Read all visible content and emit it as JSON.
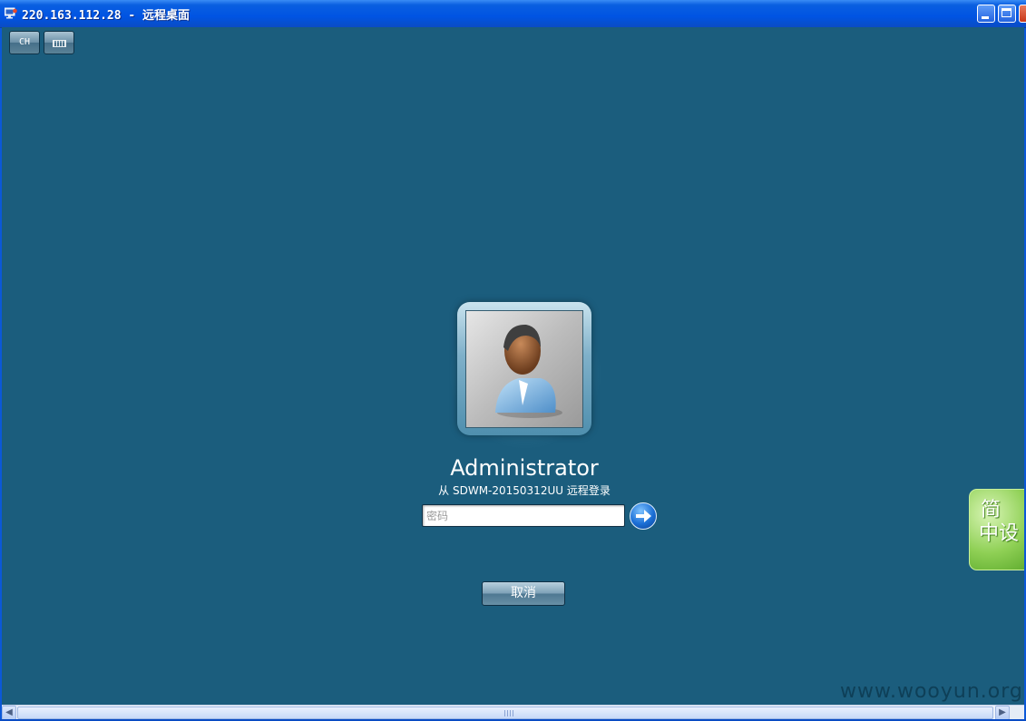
{
  "window": {
    "title": "220.163.112.28 - 远程桌面",
    "icon": "remote-desktop-icon",
    "controls": [
      "minimize",
      "maximize",
      "close"
    ]
  },
  "toolbar": {
    "language_label": "CH",
    "keyboard_icon": "keyboard-icon"
  },
  "login": {
    "user_name": "Administrator",
    "from_text": "从 SDWM-20150312UU 远程登录",
    "password_placeholder": "密码",
    "password_value": "",
    "submit_icon": "arrow-right-icon",
    "cancel_label": "取消"
  },
  "side_widget": {
    "line1": "简",
    "line2": "中设"
  },
  "watermark": "www.wooyun.org",
  "colors": {
    "desktop_bg": "#1b5d7d",
    "titlebar": "#0054e3",
    "widget_green": "#8fd055"
  }
}
